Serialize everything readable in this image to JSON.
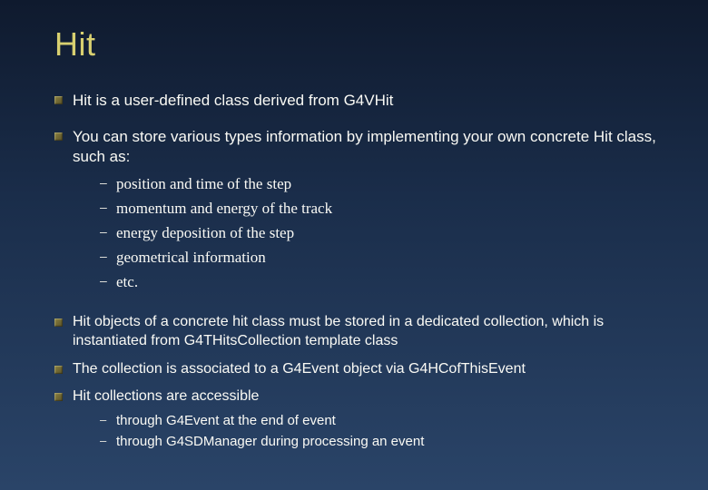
{
  "title": "Hit",
  "bullets_top": [
    "Hit is a user-defined class derived from G4VHit",
    "You can store various types information by implementing your own concrete Hit class, such as:"
  ],
  "sub_items": [
    "position and time of the step",
    "momentum and energy of the track",
    "energy deposition of the step",
    "geometrical information",
    "etc."
  ],
  "bullets_bottom": [
    "Hit objects of a concrete hit class must be stored in a dedicated collection, which is instantiated from G4THitsCollection template class",
    "The collection is associated to a G4Event object via G4HCofThisEvent",
    "Hit collections are accessible"
  ],
  "sub_items2": [
    "through G4Event at the end of event",
    "through G4SDManager during processing an event"
  ]
}
